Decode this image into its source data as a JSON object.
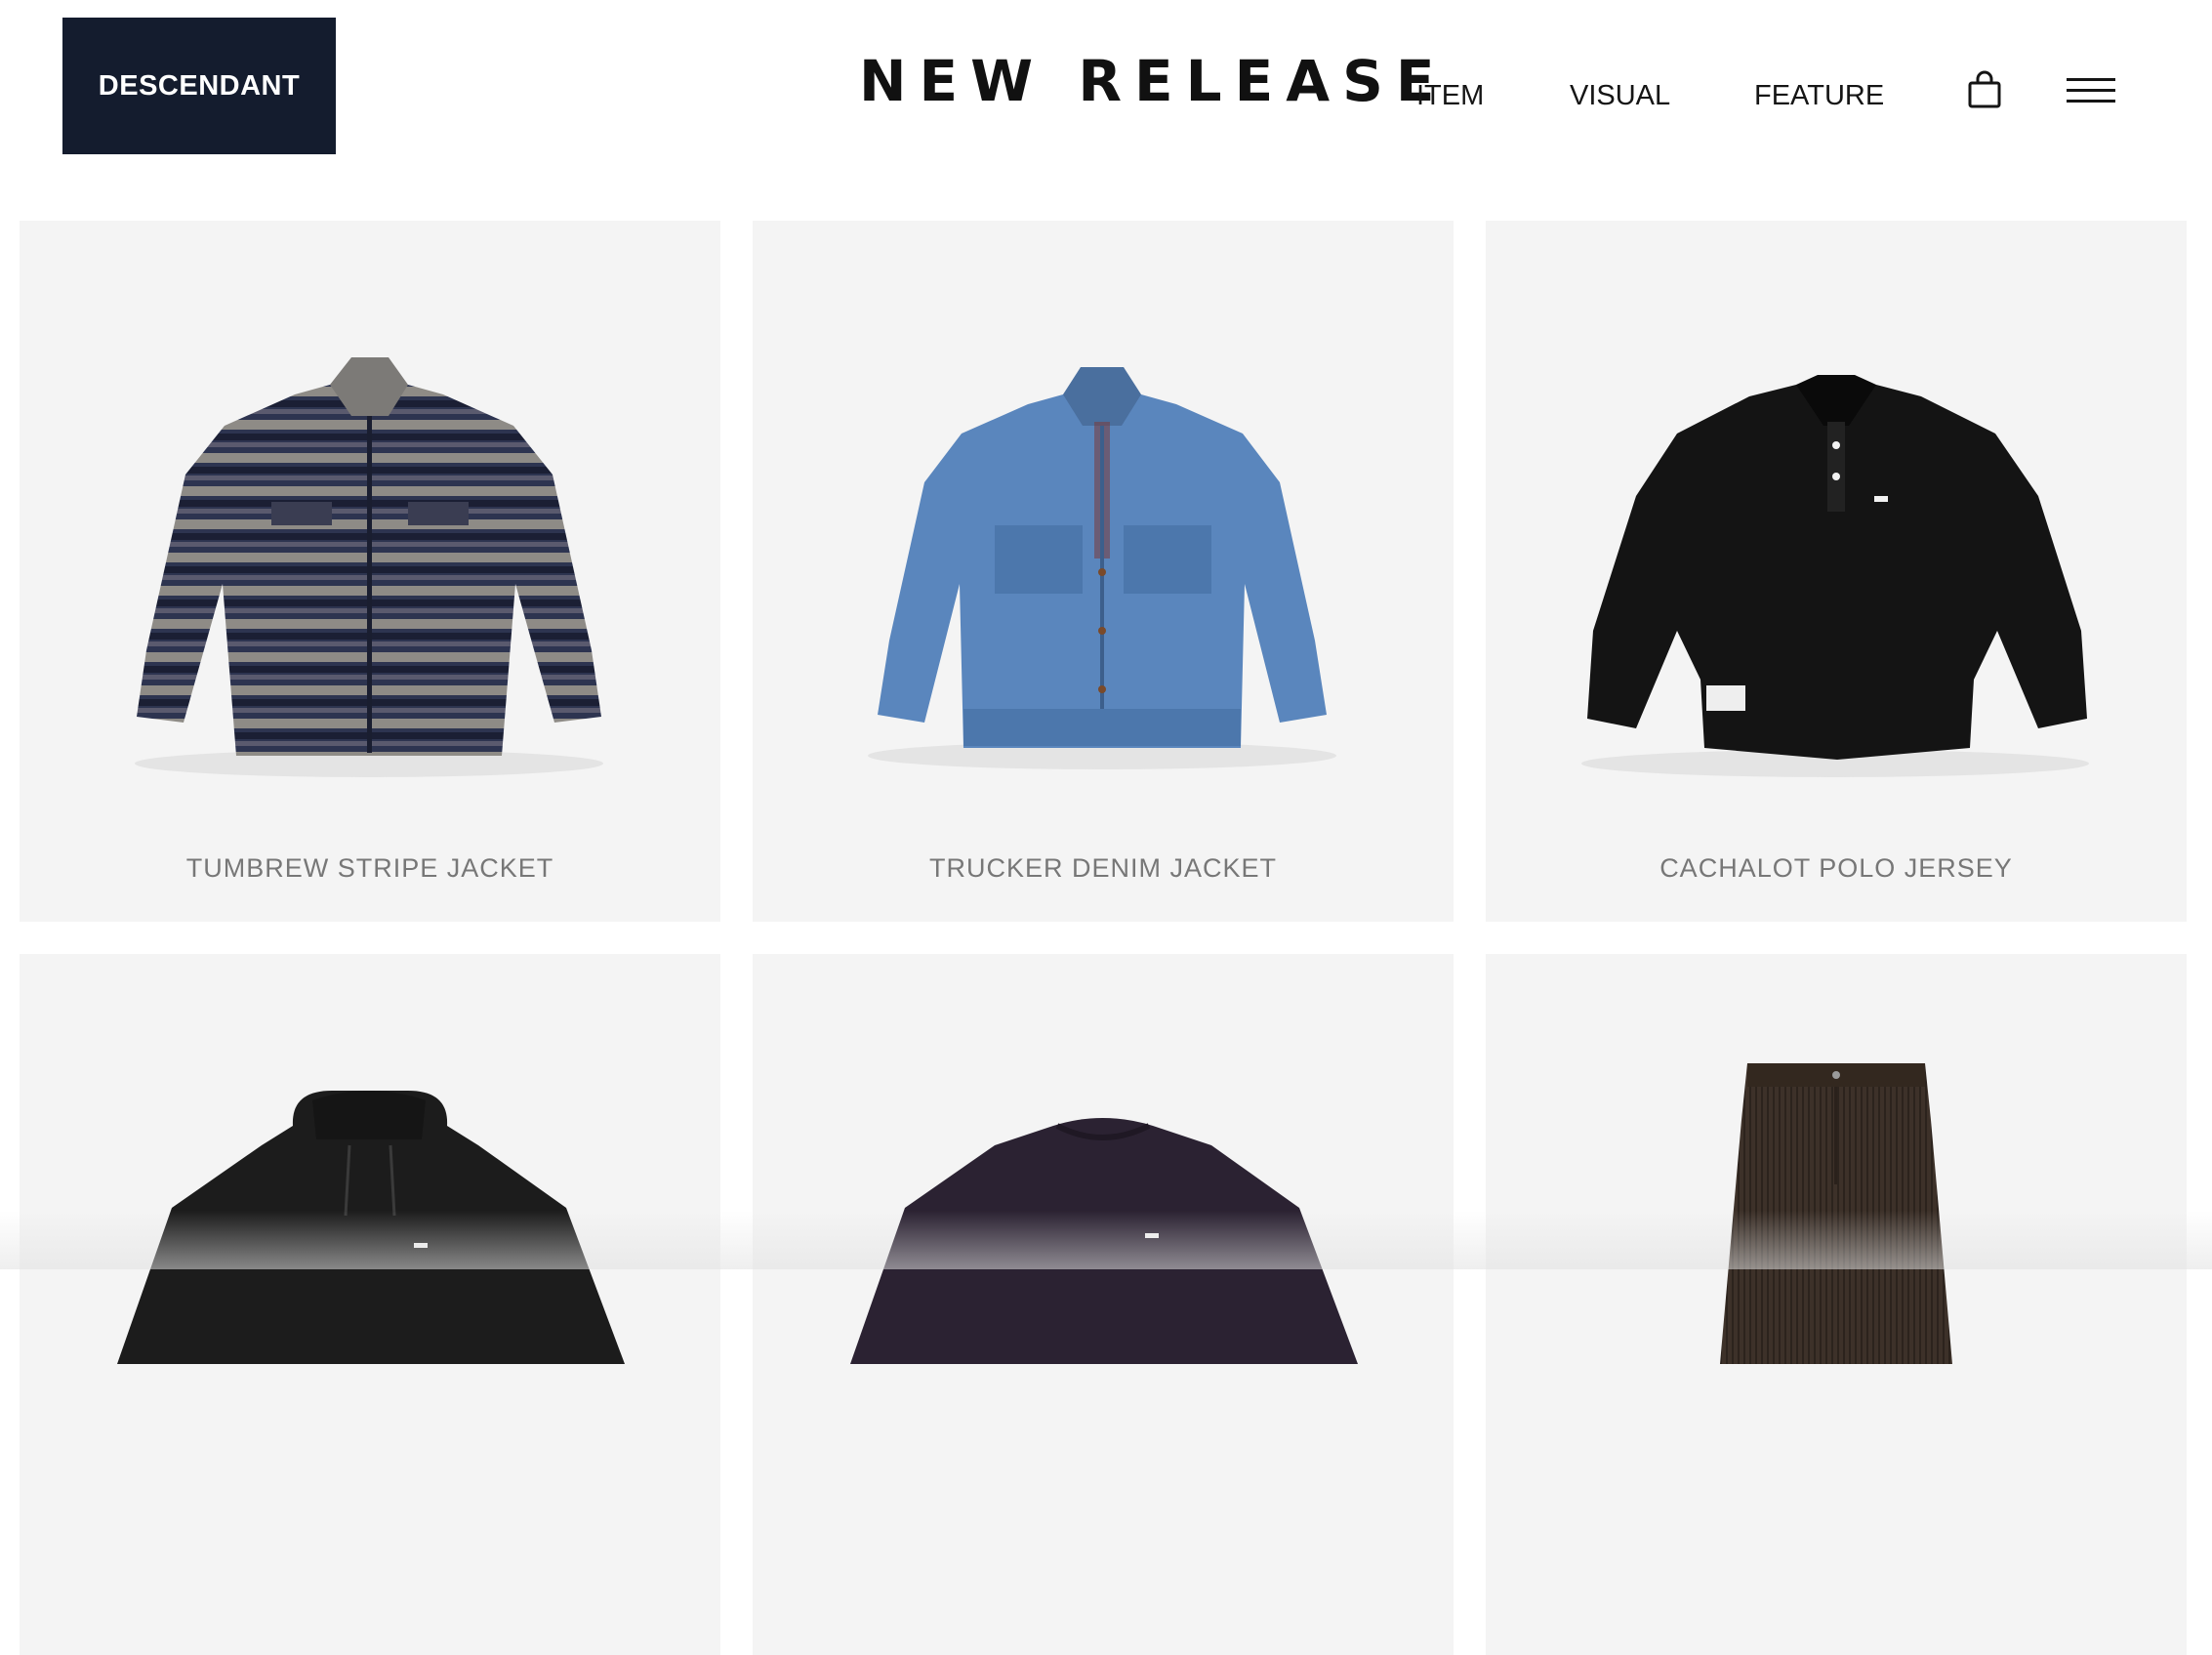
{
  "brand": {
    "logo_text": "DESCENDANT",
    "color": "#141c2e"
  },
  "header": {
    "title": "NEW RELEASE",
    "nav": [
      {
        "label": "ITEM"
      },
      {
        "label": "VISUAL"
      },
      {
        "label": "FEATURE"
      }
    ],
    "icons": [
      "shopping-bag-icon",
      "hamburger-menu-icon"
    ]
  },
  "products": [
    {
      "name": "TUMBREW STRIPE JACKET",
      "image": "striped-flannel-jacket"
    },
    {
      "name": "TRUCKER DENIM JACKET",
      "image": "blue-denim-jacket"
    },
    {
      "name": "CACHALOT POLO JERSEY",
      "image": "black-polo-sweatshirt"
    },
    {
      "name": "",
      "image": "black-hoodie"
    },
    {
      "name": "",
      "image": "purple-crewneck-sweatshirt"
    },
    {
      "name": "",
      "image": "brown-corduroy-trousers"
    }
  ],
  "colors": {
    "card_bg": "#f4f4f4",
    "text": "#151515",
    "product_name": "#777777"
  }
}
